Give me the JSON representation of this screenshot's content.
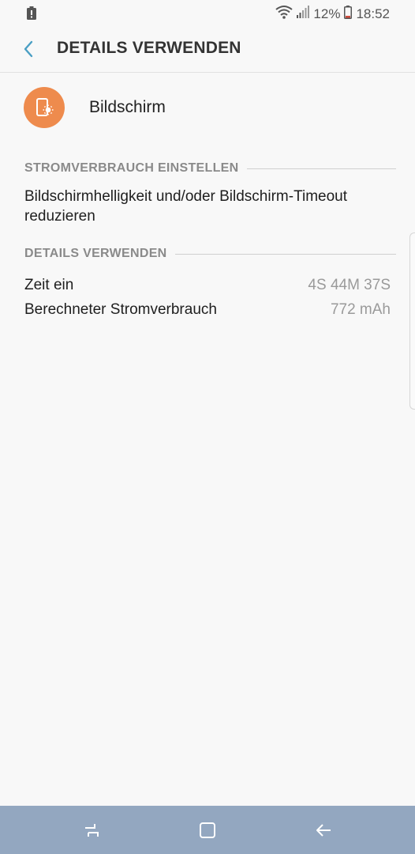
{
  "status_bar": {
    "battery_percent": "12%",
    "time": "18:52",
    "icons": [
      "alert-icon",
      "wifi-icon",
      "signal-icon",
      "battery-icon"
    ]
  },
  "header": {
    "title": "DETAILS VERWENDEN",
    "back_icon": "chevron-left-icon"
  },
  "app": {
    "name": "Bildschirm",
    "icon": "screen-settings-icon",
    "icon_color": "#ee8b4d"
  },
  "sections": {
    "power_settings": {
      "header": "STROMVERBRAUCH EINSTELLEN",
      "advice": "Bildschirmhelligkeit und/oder Bildschirm-Timeout reduzieren"
    },
    "usage_details": {
      "header": "DETAILS VERWENDEN",
      "rows": [
        {
          "label": "Zeit ein",
          "value": "4S 44M 37S"
        },
        {
          "label": "Berechneter Stromverbrauch",
          "value": "772 mAh"
        }
      ]
    }
  },
  "nav_bar": {
    "color": "#93a7c0",
    "buttons": [
      "recent-apps-icon",
      "home-icon",
      "back-arrow-icon"
    ]
  }
}
